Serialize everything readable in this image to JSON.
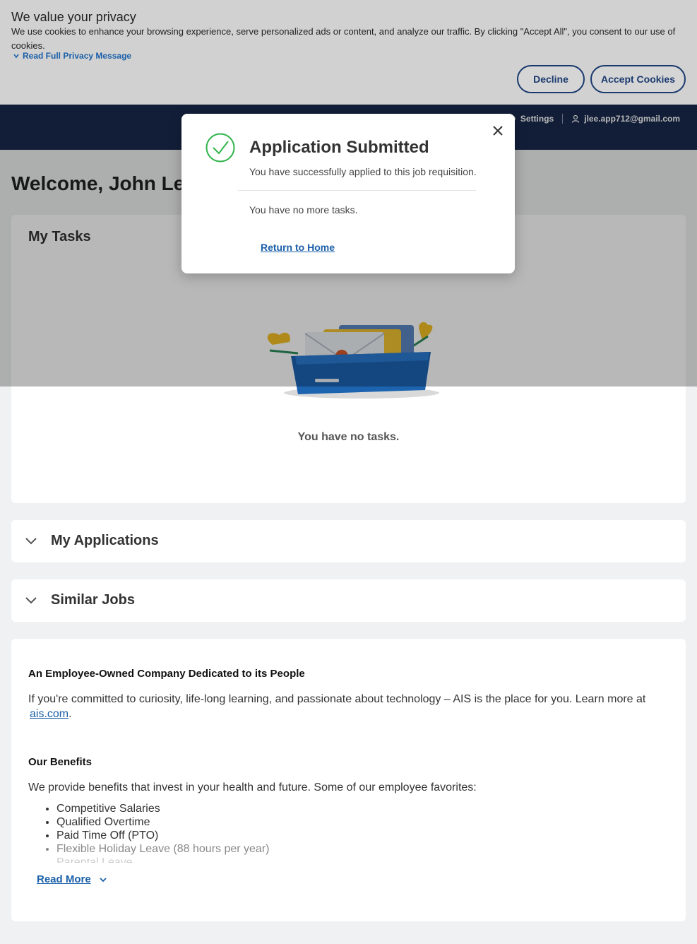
{
  "cookie_banner": {
    "title": "We value your privacy",
    "text": "We use cookies to enhance your browsing experience, serve personalized ads or content, and analyze our traffic. By clicking \"Accept All\", you consent to our use of cookies.",
    "read_more_label": "Read Full Privacy Message",
    "decline_label": "Decline",
    "accept_label": "Accept Cookies"
  },
  "nav": {
    "settings_label": "Settings",
    "user_email": "jlee.app712@gmail.com"
  },
  "welcome": "Welcome, John Lee",
  "tasks": {
    "title": "My Tasks",
    "empty_text": "You have no tasks."
  },
  "applications": {
    "title": "My Applications"
  },
  "similar_jobs": {
    "title": "Similar Jobs"
  },
  "about": {
    "heading": "An Employee-Owned Company Dedicated to its People",
    "paragraph": "If you're committed to curiosity, life-long learning, and passionate about technology – AIS is the place for you. Learn more at",
    "link_text": "ais.com",
    "link_suffix": ".",
    "benefits_heading": "Our Benefits",
    "benefits_intro": "We provide benefits that invest in your health and future. Some of our employee favorites:",
    "benefits": [
      "Competitive Salaries",
      "Qualified Overtime",
      "Paid Time Off (PTO)",
      "Flexible Holiday Leave (88 hours per year)",
      "Parental Leave"
    ],
    "read_more_label": "Read More"
  },
  "modal": {
    "title": "Application Submitted",
    "subtitle": "You have successfully applied to this job requisition.",
    "tasks_text": "You have no more tasks.",
    "link_label": "Return to Home"
  },
  "colors": {
    "nav_bg": "#1a2a4e",
    "link": "#1a5fa8",
    "success": "#2fb34a"
  }
}
